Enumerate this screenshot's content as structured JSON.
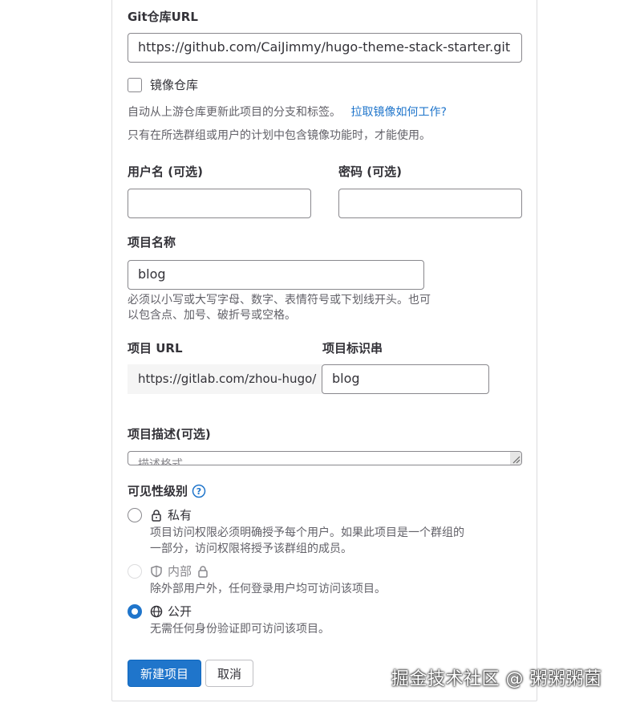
{
  "git_repo": {
    "label": "Git仓库URL",
    "value": "https://github.com/CaiJimmy/hugo-theme-stack-starter.git"
  },
  "mirror": {
    "label": "镜像仓库",
    "checked": false,
    "help_text": "自动从上游仓库更新此项目的分支和标签。",
    "help_link": "拉取镜像如何工作?",
    "help_text2": "只有在所选群组或用户的计划中包含镜像功能时，才能使用。"
  },
  "username": {
    "label": "用户名 (可选)",
    "value": ""
  },
  "password": {
    "label": "密码 (可选)",
    "value": ""
  },
  "project_name": {
    "label": "项目名称",
    "value": "blog",
    "help_line1": "必须以小写或大写字母、数字、表情符号或下划线开头。也可",
    "help_line2": "以包含点、加号、破折号或空格。"
  },
  "project_url": {
    "label": "项目 URL",
    "prefix": "https://gitlab.com/zhou-hugo/"
  },
  "project_slug": {
    "label": "项目标识串",
    "value": "blog"
  },
  "description": {
    "label": "项目描述(可选)",
    "placeholder": "描述格式"
  },
  "visibility": {
    "label": "可见性级别",
    "options": [
      {
        "label": "私有",
        "icon": "lock-icon",
        "checked": false,
        "disabled": false,
        "desc_line1": "项目访问权限必须明确授予每个用户。如果此项目是一个群组的",
        "desc_line2": "一部分，访问权限将授予该群组的成员。"
      },
      {
        "label": "内部",
        "icon": "shield-icon",
        "checked": false,
        "disabled": true,
        "desc_line1": "除外部用户外，任何登录用户均可访问该项目。"
      },
      {
        "label": "公开",
        "icon": "globe-icon",
        "checked": true,
        "disabled": false,
        "desc_line1": "无需任何身份验证即可访问该项目。"
      }
    ]
  },
  "actions": {
    "create_label": "新建项目",
    "cancel_label": "取消"
  },
  "watermark": "掘金技术社区 @ 粥粥粥菌",
  "colors": {
    "accent": "#1f75cb",
    "border": "#89888d",
    "text": "#333238",
    "muted": "#626168"
  }
}
